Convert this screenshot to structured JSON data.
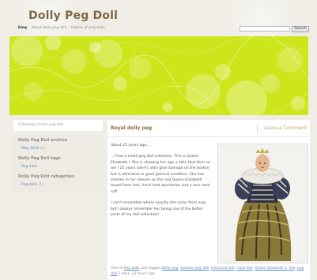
{
  "site": {
    "title": "Dolly Peg Doll"
  },
  "nav": {
    "items": [
      "blog",
      "about dolly peg doll",
      "history of peg dolls"
    ],
    "active_index": 0
  },
  "search": {
    "placeholder": "",
    "button_label": "Search"
  },
  "banner": {
    "accent": "#cde51b"
  },
  "sidebar": {
    "tagline": "A homage to the peg doll",
    "archive": {
      "title": "Dolly Peg Doll archive",
      "items": [
        {
          "label": "May 2010",
          "count": "(1)"
        }
      ]
    },
    "tags": {
      "title": "Dolly Peg Doll tags",
      "items": [
        {
          "label": "Peg dolls"
        }
      ]
    },
    "categories": {
      "title": "Dolly Peg Doll categories",
      "items": [
        {
          "label": "Peg dolls",
          "count": "(1)"
        }
      ]
    }
  },
  "post": {
    "title": "Royal dolly peg",
    "comment_link": "Leave a Comment",
    "paragraphs": [
      "About 25 years ago…",
      "…I had a small peg doll collection. This is Queen Elizabeth I. She is showing her age a little (but then so am I 25 years later!), with glue damage on the bodice but is otherwise in good general condition. She has slashes in her sleeves as the real Queen Elizabeth would have had, hand held spectacles and a lace neck ruff.",
      "I can't remember where exactly she came from now, but I always remember her being one of the better parts of my doll collection!"
    ],
    "footer": {
      "filed_prefix": "Filed in",
      "category": "Peg dolls",
      "tagged_text": "and tagged",
      "tags": [
        "Dolly peg",
        "wooden peg doll",
        "historical doll",
        "royal doll",
        "Queen Elizabeth 1. doll",
        "peg doll"
      ],
      "time": "2 days, 23 hours ago"
    }
  }
}
